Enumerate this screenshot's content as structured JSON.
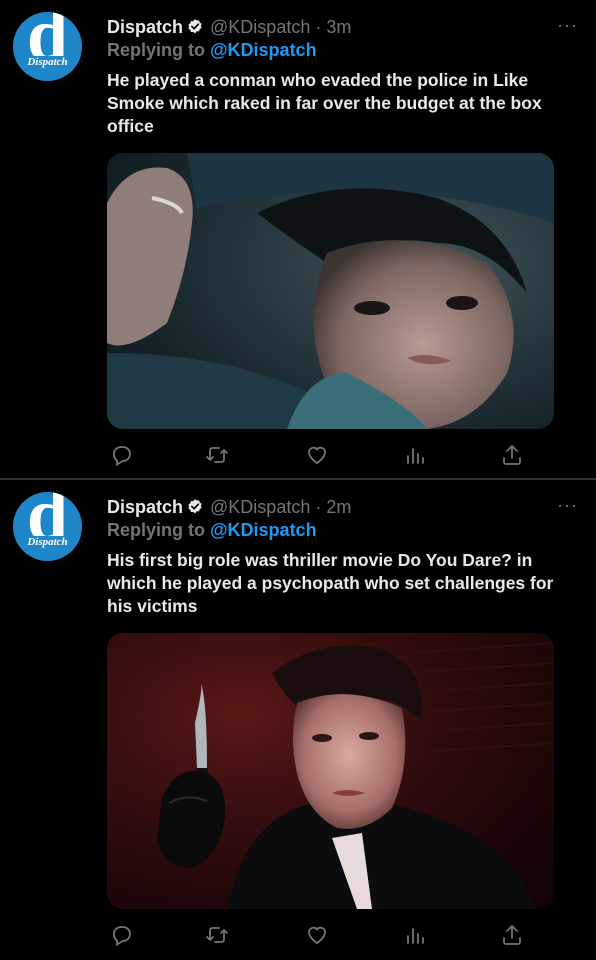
{
  "colors": {
    "background": "#000000",
    "text": "#e7e9ea",
    "muted": "#71767b",
    "link": "#1d9bf0",
    "avatar": "#1f86c9"
  },
  "tweets": [
    {
      "name": "Dispatch",
      "handle": "@KDispatch",
      "separator": "·",
      "time": "3m",
      "replying_prefix": "Replying to ",
      "replying_handle": "@KDispatch",
      "text": "He played a conman who evaded the police in Like Smoke which raked in far over the budget at the box office",
      "avatar": {
        "letter": "d",
        "tag": "news",
        "label": "Dispatch"
      },
      "more": "···"
    },
    {
      "name": "Dispatch",
      "handle": "@KDispatch",
      "separator": "·",
      "time": "2m",
      "replying_prefix": "Replying to ",
      "replying_handle": "@KDispatch",
      "text": "His first big role was thriller movie Do You Dare? in which he played a psychopath who set challenges for his victims",
      "avatar": {
        "letter": "d",
        "tag": "news",
        "label": "Dispatch"
      },
      "more": "···"
    }
  ],
  "icons": [
    "reply-icon",
    "retweet-icon",
    "like-icon",
    "analytics-icon",
    "share-icon"
  ]
}
